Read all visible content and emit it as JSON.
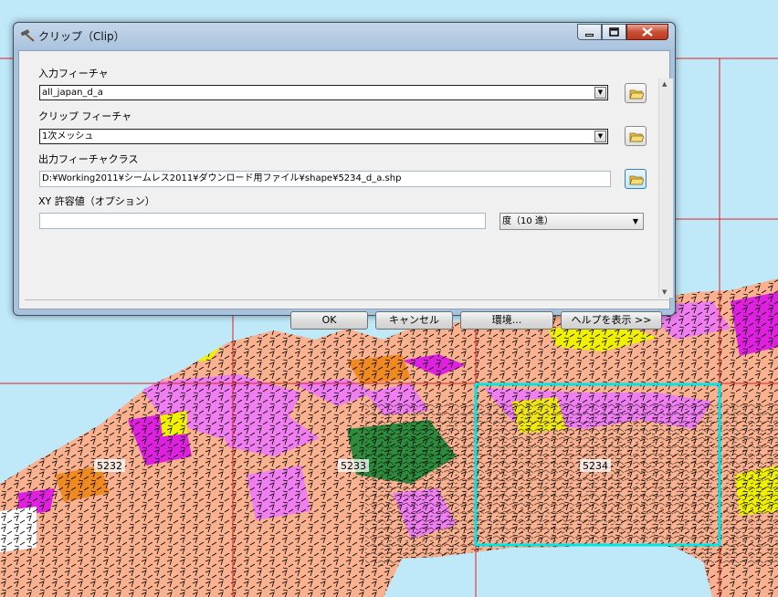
{
  "dialog": {
    "title": "クリップ（Clip）",
    "fields": {
      "input_features": {
        "label": "入力フィーチャ",
        "value": "all_japan_d_a"
      },
      "clip_features": {
        "label": "クリップ フィーチャ",
        "value": "1次メッシュ"
      },
      "output_class": {
        "label": "出力フィーチャクラス",
        "value": "D:¥Working2011¥シームレス2011¥ダウンロード用ファイル¥shape¥5234_d_a.shp"
      },
      "xy_tolerance": {
        "label": "XY 許容値（オプション）",
        "value": "",
        "unit": "度（10 進）"
      }
    },
    "buttons": {
      "ok": "OK",
      "cancel": "キャンセル",
      "environments": "環境...",
      "help": "ヘルプを表示 >>"
    }
  },
  "map": {
    "mesh_labels": [
      "5232",
      "5233",
      "5234"
    ],
    "colors": {
      "sea": "#bfe8f8",
      "grid_line": "#e02020",
      "selected_mesh": "#00e5e5",
      "salmon": "#f9b18f",
      "pink": "#f07ef0",
      "magenta": "#e020e0",
      "yellow": "#f0f000",
      "green": "#2e8b3c",
      "orange": "#f08a20"
    }
  }
}
